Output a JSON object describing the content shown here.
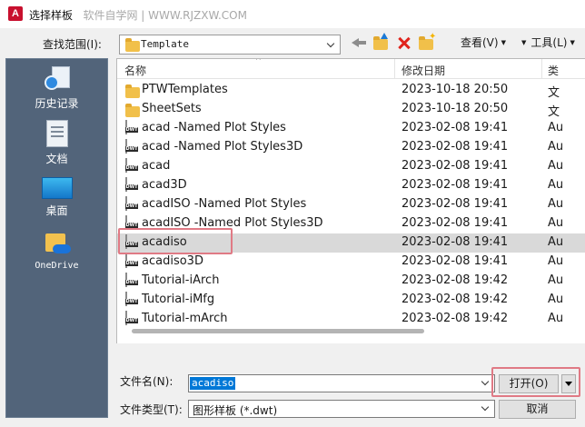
{
  "window": {
    "title": "选择样板",
    "watermark": "软件自学网 | WWW.RJZXW.COM",
    "app_logo_letter": "A"
  },
  "toolbar": {
    "look_in_label": "查找范围(I):",
    "look_in_value": "Template",
    "views_label": "查看(V)",
    "tools_label": "工具(L)"
  },
  "places": [
    {
      "label": "历史记录",
      "icon": "history-icon"
    },
    {
      "label": "文档",
      "icon": "documents-icon"
    },
    {
      "label": "桌面",
      "icon": "desktop-icon"
    },
    {
      "label": "OneDrive",
      "icon": "onedrive-icon"
    }
  ],
  "file_list": {
    "columns": {
      "name": "名称",
      "date": "修改日期",
      "type": "类"
    },
    "rows": [
      {
        "name": "PTWTemplates",
        "date": "2023-10-18 20:50",
        "type": "文",
        "kind": "folder"
      },
      {
        "name": "SheetSets",
        "date": "2023-10-18 20:50",
        "type": "文",
        "kind": "folder"
      },
      {
        "name": "acad -Named Plot Styles",
        "date": "2023-02-08 19:41",
        "type": "Au",
        "kind": "dwt"
      },
      {
        "name": "acad -Named Plot Styles3D",
        "date": "2023-02-08 19:41",
        "type": "Au",
        "kind": "dwt"
      },
      {
        "name": "acad",
        "date": "2023-02-08 19:41",
        "type": "Au",
        "kind": "dwt"
      },
      {
        "name": "acad3D",
        "date": "2023-02-08 19:41",
        "type": "Au",
        "kind": "dwt"
      },
      {
        "name": "acadISO -Named Plot Styles",
        "date": "2023-02-08 19:41",
        "type": "Au",
        "kind": "dwt"
      },
      {
        "name": "acadISO -Named Plot Styles3D",
        "date": "2023-02-08 19:41",
        "type": "Au",
        "kind": "dwt"
      },
      {
        "name": "acadiso",
        "date": "2023-02-08 19:41",
        "type": "Au",
        "kind": "dwt",
        "selected": true
      },
      {
        "name": "acadiso3D",
        "date": "2023-02-08 19:41",
        "type": "Au",
        "kind": "dwt"
      },
      {
        "name": "Tutorial-iArch",
        "date": "2023-02-08 19:42",
        "type": "Au",
        "kind": "dwt"
      },
      {
        "name": "Tutorial-iMfg",
        "date": "2023-02-08 19:42",
        "type": "Au",
        "kind": "dwt"
      },
      {
        "name": "Tutorial-mArch",
        "date": "2023-02-08 19:42",
        "type": "Au",
        "kind": "dwt"
      }
    ]
  },
  "footer": {
    "filename_label": "文件名(N):",
    "filename_value": "acadiso",
    "filetype_label": "文件类型(T):",
    "filetype_value": "图形样板 (*.dwt)",
    "open_label": "打开(O)",
    "cancel_label": "取消"
  },
  "colors": {
    "places_bg": "#52647a",
    "selected_row": "#d9d9d9",
    "highlight_box": "#e07a85",
    "selection_blue": "#0078d7"
  }
}
